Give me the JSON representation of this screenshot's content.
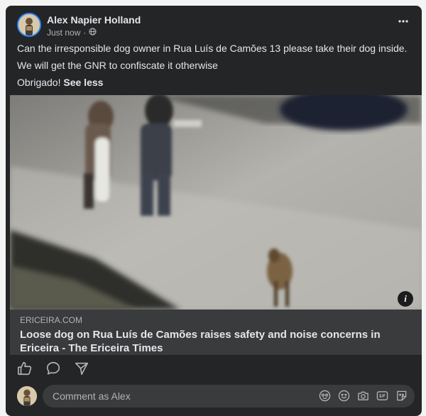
{
  "post": {
    "author": "Alex Napier Holland",
    "timestamp": "Just now",
    "separator": "·",
    "privacy_icon": "globe-icon",
    "more_icon": "more-horizontal-icon",
    "text_lines": [
      "Can the irresponsible dog owner in Rua Luís de Camões 13 please take their dog inside.",
      "We will get the GNR to confiscate it otherwise",
      "Obrigado!"
    ],
    "see_less": "See less"
  },
  "link_preview": {
    "domain": "ERICEIRA.COM",
    "title": "Loose dog on Rua Luís de Camões raises safety and noise concerns in Ericeira - The Ericeira Times",
    "info_icon": "info-icon",
    "info_label": "i"
  },
  "actions": [
    {
      "name": "like-button",
      "icon": "thumbs-up-icon"
    },
    {
      "name": "comment-button",
      "icon": "comment-bubble-icon"
    },
    {
      "name": "share-button",
      "icon": "send-icon"
    }
  ],
  "comment_box": {
    "placeholder": "Comment as Alex",
    "tools": [
      "avatar-sticker-icon",
      "emoji-icon",
      "camera-icon",
      "gif-icon",
      "sticker-icon"
    ]
  },
  "colors": {
    "card_bg": "#242526",
    "link_box_bg": "#3a3b3c",
    "text_primary": "#e4e6eb",
    "text_secondary": "#b0b3b8",
    "avatar_ring": "#2d88ff"
  }
}
